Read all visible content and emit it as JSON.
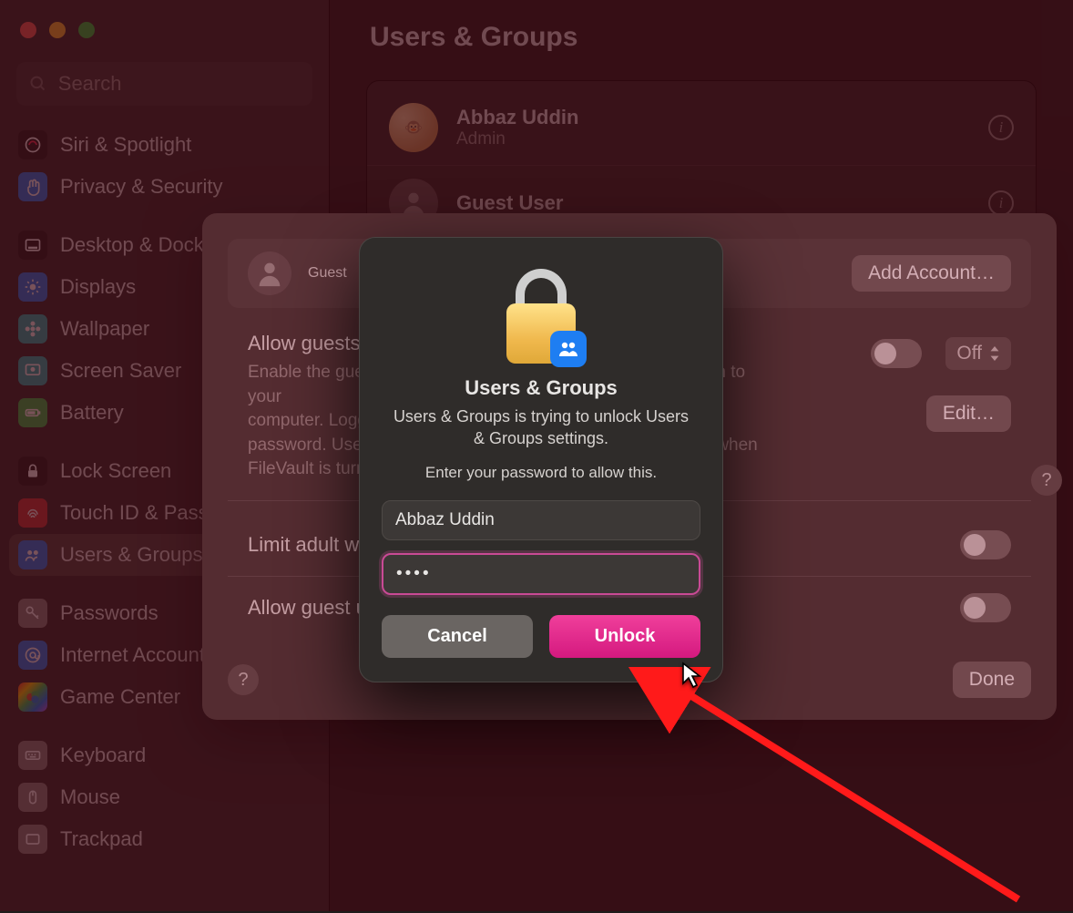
{
  "window": {
    "search_placeholder": "Search"
  },
  "sidebar": {
    "items": [
      {
        "label": "Siri & Spotlight",
        "icon": "siri",
        "bg": "#1a1a1a"
      },
      {
        "label": "Privacy & Security",
        "icon": "hand",
        "bg": "#1e7ef2"
      },
      {
        "label": "Desktop & Dock",
        "icon": "dock",
        "bg": "#1a1a1a"
      },
      {
        "label": "Displays",
        "icon": "sun",
        "bg": "#1e7ef2"
      },
      {
        "label": "Wallpaper",
        "icon": "flower",
        "bg": "#1fb7b2"
      },
      {
        "label": "Screen Saver",
        "icon": "screensaver",
        "bg": "#1fb7b2"
      },
      {
        "label": "Battery",
        "icon": "battery",
        "bg": "#31c24d"
      },
      {
        "label": "Lock Screen",
        "icon": "lock",
        "bg": "#1a1a1a"
      },
      {
        "label": "Touch ID & Password",
        "icon": "touchid",
        "bg": "#d33a3a"
      },
      {
        "label": "Users & Groups",
        "icon": "users",
        "bg": "#1e7ef2",
        "selected": true
      },
      {
        "label": "Passwords",
        "icon": "key",
        "bg": "#8a8683"
      },
      {
        "label": "Internet Accounts",
        "icon": "at",
        "bg": "#1e7ef2"
      },
      {
        "label": "Game Center",
        "icon": "gamecenter",
        "bg": "linear-gradient(135deg,#ff3b30,#ffcc00,#34c759,#0a84ff,#bf5af2)"
      },
      {
        "label": "Keyboard",
        "icon": "keyboard",
        "bg": "#8a8683"
      },
      {
        "label": "Mouse",
        "icon": "mouse",
        "bg": "#8a8683"
      },
      {
        "label": "Trackpad",
        "icon": "trackpad",
        "bg": "#8a8683"
      }
    ],
    "groups": [
      2,
      7,
      10,
      13
    ]
  },
  "main": {
    "title": "Users & Groups",
    "users": [
      {
        "name": "Abbaz Uddin",
        "role": "Admin",
        "avatar": "monkey"
      },
      {
        "name": "Guest User",
        "role": "",
        "avatar": "silhouette"
      }
    ]
  },
  "sheet": {
    "guest_label": "Guest",
    "add_account_label": "Add Account…",
    "allow_guests": {
      "title": "Allow guests to log in to this computer",
      "desc_1": "Enable the guest account so that friends can temporarily log in to your",
      "desc_2": "computer. Logging in to the guest account does not require a",
      "desc_3": "password. Users cannot log in to the guest account remotely when",
      "desc_4": "FileVault is turned on."
    },
    "off_label": "Off",
    "edit_label": "Edit…",
    "limit_adult_label": "Limit adult websites",
    "allow_connect_label": "Allow guest users to connect to shared folders",
    "done_label": "Done"
  },
  "auth": {
    "title": "Users & Groups",
    "message": "Users & Groups is trying to unlock Users & Groups settings.",
    "prompt": "Enter your password to allow this.",
    "username": "Abbaz Uddin",
    "password_display": "••••",
    "cancel_label": "Cancel",
    "unlock_label": "Unlock"
  }
}
